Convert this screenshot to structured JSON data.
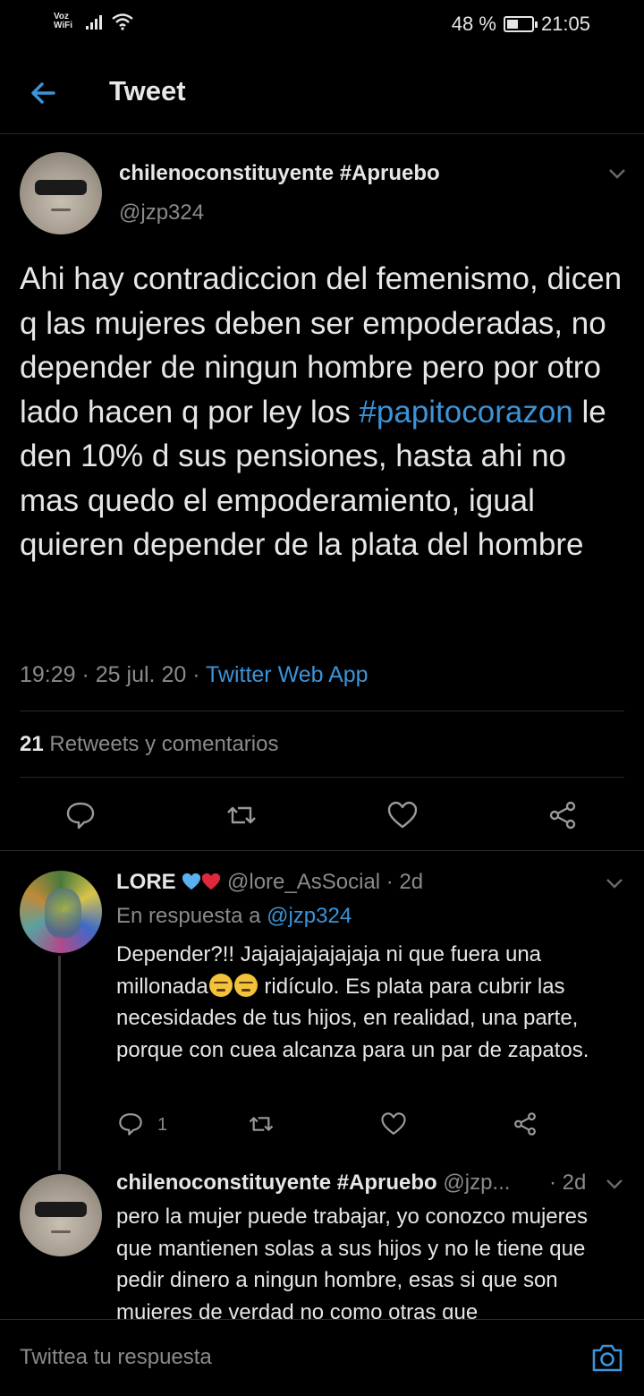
{
  "statusbar": {
    "carrier_line1": "Voz",
    "carrier_line2": "WiFi",
    "battery": "48 %",
    "battery_level": 0.48,
    "time": "21:05"
  },
  "header": {
    "title": "Tweet"
  },
  "main_tweet": {
    "display_name": "chilenoconstituyente #Apruebo",
    "handle": "@jzp324",
    "text_before": "Ahi hay contradiccion del femenismo, dicen q las mujeres deben ser empoderadas, no depender de ningun hombre pero por otro lado hacen q por ley los ",
    "hashtag": "#papitocorazon",
    "text_after": " le den 10% d sus pensiones, hasta ahi no mas quedo el empoderamiento, igual quieren depender de la plata del hombre",
    "time": "19:29",
    "date": "25 jul. 20",
    "source": "Twitter Web App",
    "sep": " · ",
    "retweet_count": "21",
    "retweet_label": "Retweets y comentarios"
  },
  "reply1": {
    "display_name": "LORE",
    "handle_age": "@lore_AsSocial · 2d",
    "in_reply_prefix": "En respuesta a ",
    "in_reply_handle": "@jzp324",
    "text_a": "Depender?!! Jajajajajajajaja ni que fuera una millonada",
    "text_b": " ridículo. Es plata para cubrir las necesidades de tus hijos, en realidad, una parte, porque con cuea alcanza para un par de zapatos.",
    "reply_count": "1"
  },
  "reply2": {
    "display_name": "chilenoconstituyente #Apruebo",
    "handle": "@jzp...",
    "age": "· 2d",
    "text": "pero la mujer puede trabajar, yo conozco mujeres que mantienen solas a sus hijos y no le tiene que pedir dinero a ningun hombre, esas si que son mujeres de verdad no como otras que"
  },
  "composer": {
    "placeholder": "Twittea tu respuesta"
  },
  "colors": {
    "link": "#3b94d9",
    "background": "#000000",
    "muted": "#8a8a8a"
  },
  "icons": [
    "back-arrow-icon",
    "chevron-down-icon",
    "reply-icon",
    "retweet-icon",
    "like-icon",
    "share-icon",
    "camera-icon",
    "wifi-icon",
    "signal-icon",
    "battery-icon"
  ]
}
